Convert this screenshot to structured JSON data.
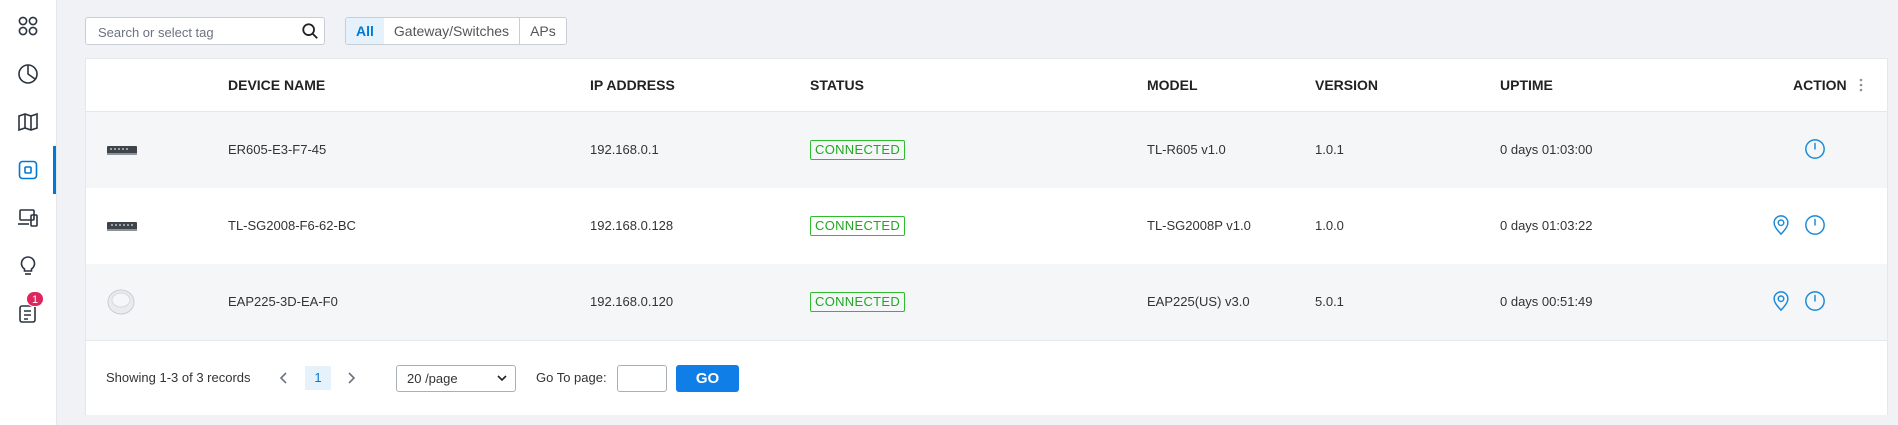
{
  "sidebar": {
    "items": [
      {
        "name": "dashboard-icon"
      },
      {
        "name": "statistics-icon"
      },
      {
        "name": "map-icon"
      },
      {
        "name": "devices-icon",
        "active": true
      },
      {
        "name": "clients-icon"
      },
      {
        "name": "insight-icon"
      },
      {
        "name": "logs-icon",
        "badge": "1"
      }
    ]
  },
  "toolbar": {
    "search_placeholder": "Search or select tag",
    "filters": [
      "All",
      "Gateway/Switches",
      "APs"
    ],
    "active_filter": "All"
  },
  "table": {
    "headers": {
      "device_name": "DEVICE NAME",
      "ip_address": "IP ADDRESS",
      "status": "STATUS",
      "model": "MODEL",
      "version": "VERSION",
      "uptime": "UPTIME",
      "action": "ACTION"
    },
    "rows": [
      {
        "device_type": "gateway",
        "name": "ER605-E3-F7-45",
        "ip": "192.168.0.1",
        "status": "CONNECTED",
        "model": "TL-R605 v1.0",
        "version": "1.0.1",
        "uptime": "0 days 01:03:00",
        "actions": [
          "power-icon"
        ]
      },
      {
        "device_type": "switch",
        "name": "TL-SG2008-F6-62-BC",
        "ip": "192.168.0.128",
        "status": "CONNECTED",
        "model": "TL-SG2008P v1.0",
        "version": "1.0.0",
        "uptime": "0 days 01:03:22",
        "actions": [
          "locate-icon",
          "power-icon"
        ]
      },
      {
        "device_type": "access-point",
        "name": "EAP225-3D-EA-F0",
        "ip": "192.168.0.120",
        "status": "CONNECTED",
        "model": "EAP225(US) v3.0",
        "version": "5.0.1",
        "uptime": "0 days 00:51:49",
        "actions": [
          "locate-icon",
          "power-icon"
        ]
      }
    ]
  },
  "pagination": {
    "summary": "Showing 1-3 of 3 records",
    "current_page": "1",
    "page_size": "20 /page",
    "goto_label": "Go To page:",
    "go_label": "GO"
  },
  "colors": {
    "accent": "#0078d4",
    "connected": "#1fa81f",
    "badge": "#e0245e"
  }
}
